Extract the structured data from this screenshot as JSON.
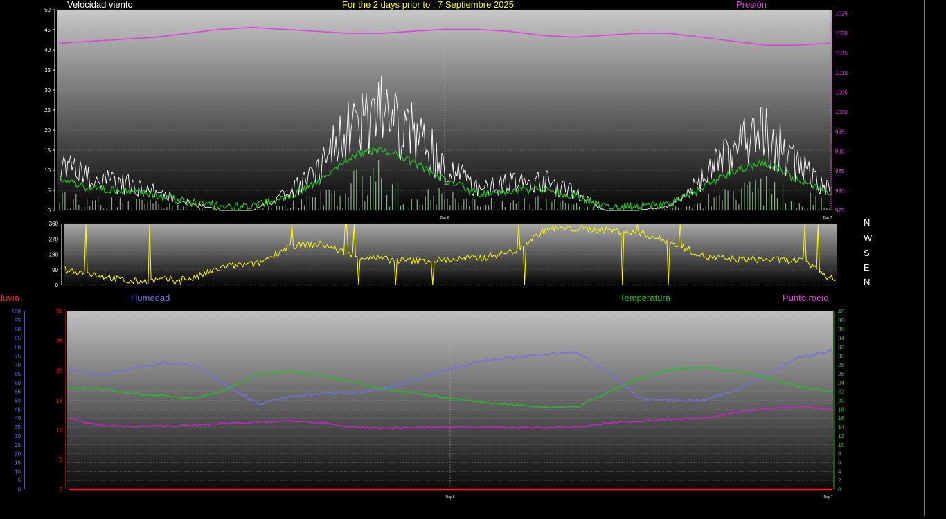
{
  "header": {
    "left_label": "Velocidad viento",
    "center_label": "For the 2 days prior to : 7 Septiembre 2025",
    "right_label": "Presión"
  },
  "lower_header": {
    "rain_label": "Lluvia",
    "humidity_label": "Humedad",
    "temperature_label": "Temperatura",
    "dewpoint_label": "Punto rocío"
  },
  "compass": [
    "N",
    "W",
    "S",
    "E",
    "N"
  ],
  "colors": {
    "wind": "#ffffff",
    "wind_avg": "#22c022",
    "pressure": "#e040e0",
    "direction": "#ffff00",
    "humidity": "#7070e0",
    "temperature": "#22c022",
    "dewpoint": "#d020d0",
    "rain": "#ff2020",
    "title": "#ffff00"
  },
  "chart_data": [
    {
      "type": "line",
      "name": "wind-pressure",
      "x_ticks": [
        "Day 6",
        "Day 7"
      ],
      "y_left": {
        "min": 0,
        "max": 50,
        "ticks": [
          0,
          5,
          10,
          15,
          20,
          25,
          30,
          35,
          40,
          45,
          50
        ]
      },
      "y_right": {
        "min": 975,
        "max": 1026,
        "ticks": [
          975,
          980,
          985,
          990,
          995,
          1000,
          1005,
          1010,
          1015,
          1020,
          1025
        ]
      },
      "series": [
        {
          "name": "Velocidad viento",
          "axis": "left",
          "x": [
            0,
            2,
            4,
            6,
            8,
            10,
            12,
            14,
            16,
            18,
            20,
            22,
            24,
            26,
            28,
            30,
            32,
            34,
            36,
            38,
            40,
            42,
            44,
            46,
            48
          ],
          "values": [
            12,
            8,
            7,
            5,
            2,
            0,
            0,
            4,
            10,
            22,
            26,
            20,
            12,
            6,
            7,
            8,
            5,
            0,
            0,
            1,
            8,
            16,
            20,
            12,
            5
          ]
        },
        {
          "name": "Presión",
          "axis": "right",
          "x": [
            0,
            2,
            4,
            6,
            8,
            10,
            12,
            14,
            16,
            18,
            20,
            22,
            24,
            26,
            28,
            30,
            32,
            34,
            36,
            38,
            40,
            42,
            44,
            46,
            48
          ],
          "values": [
            1017.5,
            1018,
            1018.5,
            1019,
            1020,
            1021,
            1021.5,
            1021,
            1020.5,
            1020,
            1020,
            1020.5,
            1021,
            1021,
            1020.5,
            1019.5,
            1019,
            1019.5,
            1020,
            1020,
            1019,
            1018,
            1017,
            1017,
            1017.5
          ]
        }
      ]
    },
    {
      "type": "line",
      "name": "wind-direction",
      "y": {
        "min": 0,
        "max": 360,
        "ticks": [
          0,
          90,
          180,
          270,
          360
        ]
      },
      "series": [
        {
          "name": "direction",
          "x": [
            0,
            2,
            4,
            6,
            8,
            10,
            12,
            14,
            16,
            18,
            20,
            22,
            24,
            26,
            28,
            30,
            32,
            34,
            36,
            38,
            40,
            42,
            44,
            46,
            48
          ],
          "values": [
            90,
            60,
            20,
            30,
            40,
            110,
            125,
            230,
            240,
            170,
            150,
            140,
            150,
            160,
            200,
            330,
            330,
            320,
            300,
            240,
            160,
            150,
            150,
            140,
            20
          ]
        }
      ]
    },
    {
      "type": "line",
      "name": "humidity-temperature",
      "x_ticks": [
        "Day 6",
        "Day 7"
      ],
      "y_humidity": {
        "min": 0,
        "max": 100,
        "ticks": [
          0,
          5,
          10,
          15,
          20,
          25,
          30,
          35,
          40,
          45,
          50,
          55,
          60,
          65,
          70,
          75,
          80,
          85,
          90,
          95,
          100
        ]
      },
      "y_left": {
        "min": 0,
        "max": 30,
        "ticks": [
          0,
          5,
          10,
          15,
          20,
          25,
          30
        ]
      },
      "y_right": {
        "min": 0,
        "max": 40,
        "ticks": [
          0,
          2,
          4,
          6,
          8,
          10,
          12,
          14,
          16,
          18,
          20,
          22,
          24,
          26,
          28,
          30,
          32,
          34,
          36,
          38,
          40
        ]
      },
      "series": [
        {
          "name": "Humedad",
          "axis": "humidity",
          "x": [
            0,
            2,
            4,
            6,
            8,
            10,
            12,
            14,
            16,
            18,
            20,
            22,
            24,
            26,
            28,
            30,
            32,
            34,
            36,
            38,
            40,
            42,
            44,
            46,
            48
          ],
          "values": [
            68,
            64,
            68,
            71,
            70,
            58,
            48,
            52,
            54,
            54,
            57,
            62,
            68,
            72,
            74,
            76,
            77,
            65,
            51,
            50,
            50,
            56,
            65,
            74,
            78
          ]
        },
        {
          "name": "Temperatura",
          "axis": "right",
          "x": [
            0,
            2,
            4,
            6,
            8,
            10,
            12,
            14,
            16,
            18,
            20,
            22,
            24,
            26,
            28,
            30,
            32,
            34,
            36,
            38,
            40,
            42,
            44,
            46,
            48
          ],
          "values": [
            23,
            22.5,
            21.5,
            21,
            20.5,
            22.5,
            26,
            26.5,
            25.5,
            24,
            22.5,
            21.5,
            20.5,
            19.5,
            19,
            18.5,
            18.5,
            22,
            25,
            27,
            27.5,
            26.5,
            25,
            23,
            22
          ]
        },
        {
          "name": "Punto rocío",
          "axis": "left",
          "x": [
            0,
            2,
            4,
            6,
            8,
            10,
            12,
            14,
            16,
            18,
            20,
            22,
            24,
            26,
            28,
            30,
            32,
            34,
            36,
            38,
            40,
            42,
            44,
            46,
            48
          ],
          "values": [
            12,
            10.8,
            10.6,
            10.7,
            10.8,
            11.2,
            11.3,
            11.5,
            11.2,
            10.4,
            10.3,
            10.4,
            10.5,
            10.5,
            10.4,
            10.4,
            10.5,
            11.2,
            11.5,
            11.7,
            12,
            13,
            13.6,
            14,
            13.5
          ]
        },
        {
          "name": "Lluvia",
          "axis": "left",
          "x": [
            0,
            48
          ],
          "values": [
            0,
            0
          ]
        }
      ]
    }
  ]
}
